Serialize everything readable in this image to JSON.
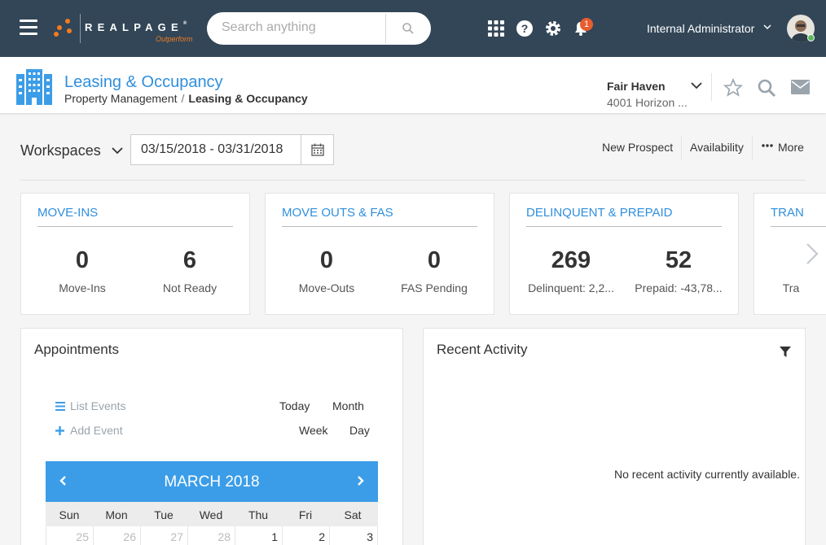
{
  "topbar": {
    "brand": "REALPAGE",
    "brand_mark": "®",
    "brand_sub": "Outperform",
    "search_placeholder": "Search anything",
    "notification_count": "1",
    "user_name": "Internal Administrator"
  },
  "header": {
    "title": "Leasing & Occupancy",
    "breadcrumb": [
      "Property Management",
      "Leasing & Occupancy"
    ],
    "property_name": "Fair Haven",
    "property_address": "4001 Horizon ..."
  },
  "workspace": {
    "label": "Workspaces",
    "date_range": "03/15/2018 - 03/31/2018",
    "actions": [
      "New Prospect",
      "Availability",
      "More"
    ]
  },
  "tiles": [
    {
      "title": "MOVE-INS",
      "metrics": [
        {
          "value": "0",
          "label": "Move-Ins"
        },
        {
          "value": "6",
          "label": "Not Ready"
        }
      ]
    },
    {
      "title": "MOVE OUTS & FAS",
      "metrics": [
        {
          "value": "0",
          "label": "Move-Outs"
        },
        {
          "value": "0",
          "label": "FAS Pending"
        }
      ]
    },
    {
      "title": "DELINQUENT & PREPAID",
      "metrics": [
        {
          "value": "269",
          "label": "Delinquent: 2,2..."
        },
        {
          "value": "52",
          "label": "Prepaid: -43,78..."
        }
      ]
    },
    {
      "title": "TRAN",
      "metrics": [
        {
          "value": "",
          "label": "Tra"
        }
      ]
    }
  ],
  "appointments": {
    "title": "Appointments",
    "list_events": "List Events",
    "add_event": "Add Event",
    "views": [
      "Today",
      "Month",
      "Week",
      "Day"
    ],
    "calendar": {
      "month": "MARCH 2018",
      "weekdays": [
        "Sun",
        "Mon",
        "Tue",
        "Wed",
        "Thu",
        "Fri",
        "Sat"
      ],
      "first_row": [
        "25",
        "26",
        "27",
        "28",
        "1",
        "2",
        "3"
      ]
    }
  },
  "recent_activity": {
    "title": "Recent Activity",
    "empty_message": "No recent activity currently available."
  },
  "colors": {
    "topbar": "#324657",
    "brand_orange": "#f47b20",
    "accent_blue": "#2f8fdd",
    "calendar_header": "#3b9de8",
    "badge": "#e85c2d"
  }
}
